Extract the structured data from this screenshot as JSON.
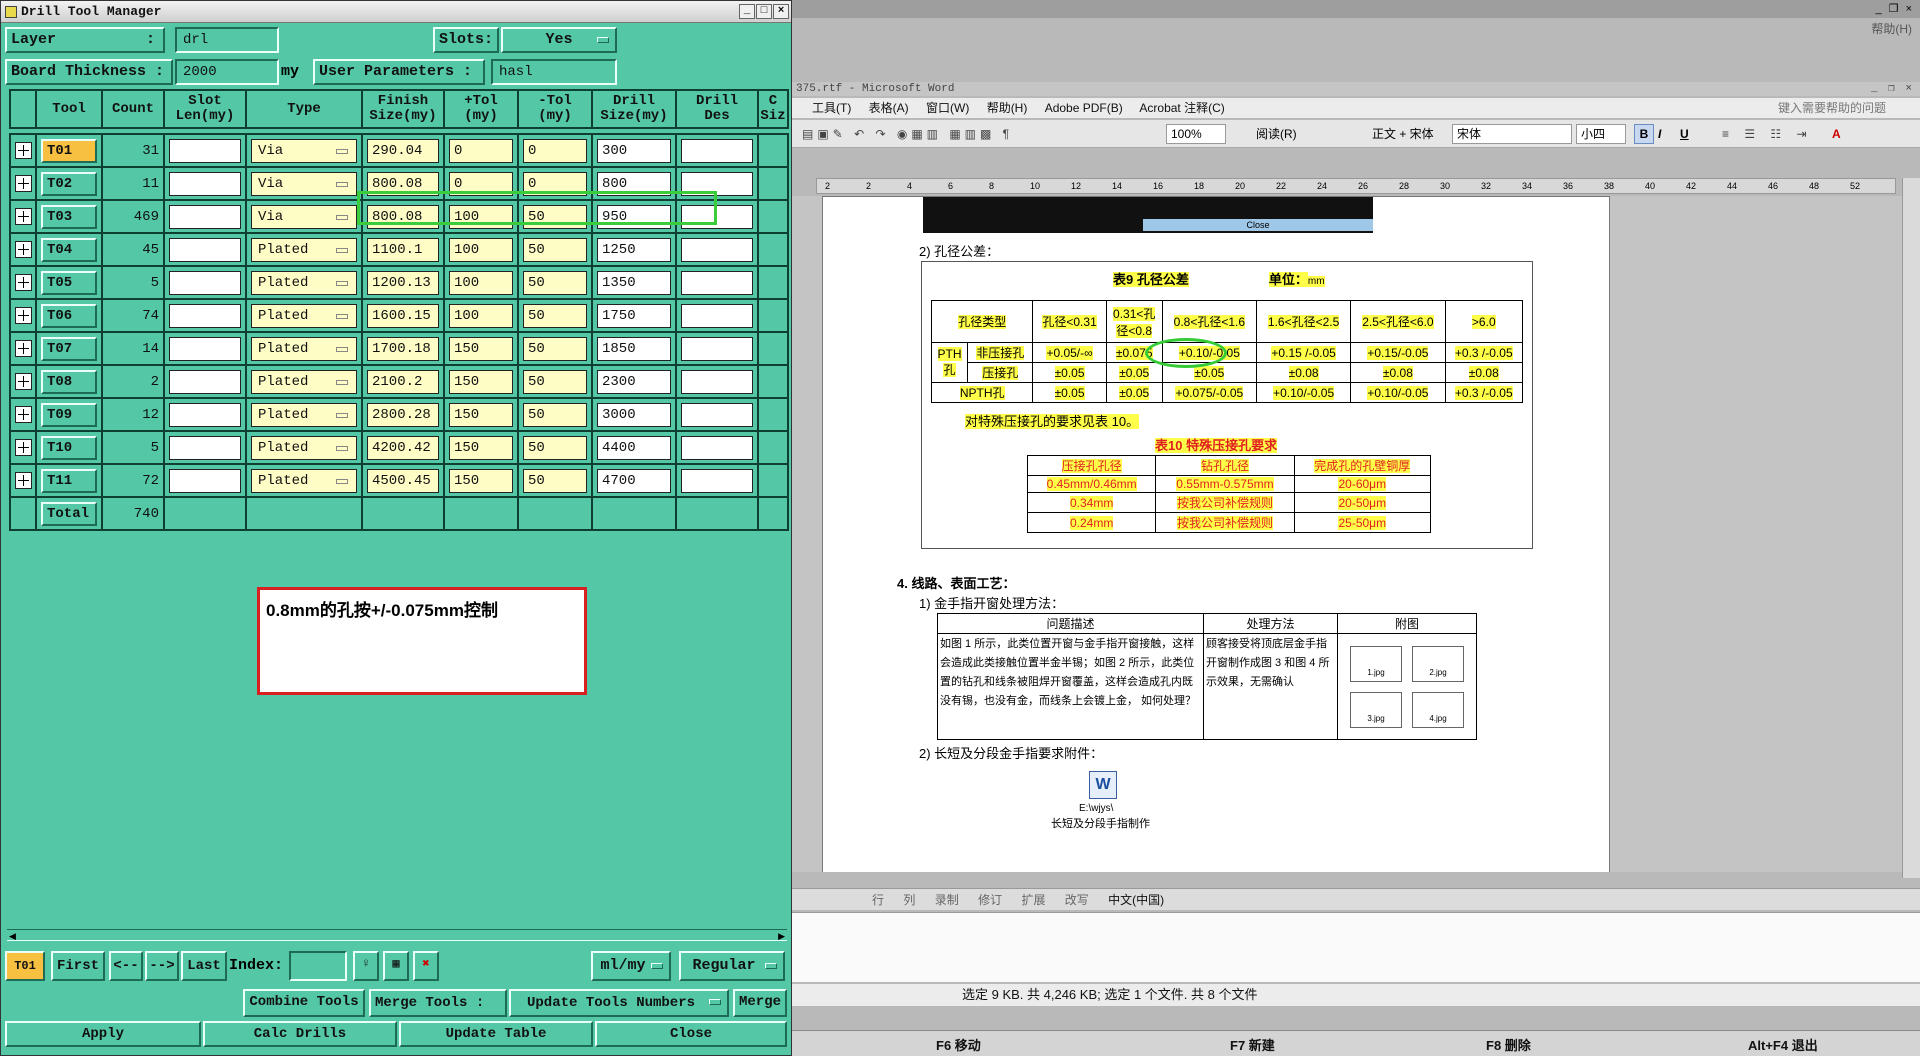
{
  "dtm": {
    "title": "Drill Tool Manager",
    "layer_label": "Layer",
    "layer_colon": ":",
    "layer_value": "drl",
    "slots_label": "Slots:",
    "slots_value": "Yes",
    "thickness_label": "Board Thickness  :",
    "thickness_value": "2000",
    "thickness_unit": "my",
    "userparam_label": "User Parameters  :",
    "userparam_value": "hasl",
    "headers": [
      "Tool",
      "Count",
      "Slot\nLen(my)",
      "Type",
      "Finish\nSize(my)",
      "+Tol\n(my)",
      "-Tol\n(my)",
      "Drill\nSize(my)",
      "Drill\nDes",
      "C\nSiz"
    ],
    "rows": [
      {
        "tool": "T01",
        "count": "31",
        "type": "Via",
        "finish": "290.04",
        "ptol": "0",
        "ntol": "0",
        "drill": "300"
      },
      {
        "tool": "T02",
        "count": "11",
        "type": "Via",
        "finish": "800.08",
        "ptol": "0",
        "ntol": "0",
        "drill": "800"
      },
      {
        "tool": "T03",
        "count": "469",
        "type": "Via",
        "finish": "800.08",
        "ptol": "100",
        "ntol": "50",
        "drill": "950"
      },
      {
        "tool": "T04",
        "count": "45",
        "type": "Plated",
        "finish": "1100.1",
        "ptol": "100",
        "ntol": "50",
        "drill": "1250"
      },
      {
        "tool": "T05",
        "count": "5",
        "type": "Plated",
        "finish": "1200.13",
        "ptol": "100",
        "ntol": "50",
        "drill": "1350"
      },
      {
        "tool": "T06",
        "count": "74",
        "type": "Plated",
        "finish": "1600.15",
        "ptol": "100",
        "ntol": "50",
        "drill": "1750"
      },
      {
        "tool": "T07",
        "count": "14",
        "type": "Plated",
        "finish": "1700.18",
        "ptol": "150",
        "ntol": "50",
        "drill": "1850"
      },
      {
        "tool": "T08",
        "count": "2",
        "type": "Plated",
        "finish": "2100.2",
        "ptol": "150",
        "ntol": "50",
        "drill": "2300"
      },
      {
        "tool": "T09",
        "count": "12",
        "type": "Plated",
        "finish": "2800.28",
        "ptol": "150",
        "ntol": "50",
        "drill": "3000"
      },
      {
        "tool": "T10",
        "count": "5",
        "type": "Plated",
        "finish": "4200.42",
        "ptol": "150",
        "ntol": "50",
        "drill": "4400"
      },
      {
        "tool": "T11",
        "count": "72",
        "type": "Plated",
        "finish": "4500.45",
        "ptol": "150",
        "ntol": "50",
        "drill": "4700"
      }
    ],
    "total_label": "Total",
    "total_count": "740",
    "annotation": "0.8mm的孔按+/-0.075mm控制",
    "nav": {
      "current": "T01",
      "first": "First",
      "prev": "<--",
      "next": "-->",
      "last": "Last",
      "index_label": "Index:",
      "units": "ml/my",
      "mode": "Regular"
    },
    "actions": {
      "combine": "Combine Tools",
      "merge_label": "Merge Tools :",
      "update_numbers": "Update Tools Numbers",
      "merge": "Merge",
      "apply": "Apply",
      "calc": "Calc Drills",
      "update_table": "Update Table",
      "close": "Close"
    }
  },
  "word": {
    "help_menu": "帮助(H)",
    "title": "375.rtf - Microsoft Word",
    "menus": [
      "工具(T)",
      "表格(A)",
      "窗口(W)",
      "帮助(H)",
      "Adobe PDF(B)",
      "Acrobat 注释(C)"
    ],
    "help_search": "键入需要帮助的问题",
    "zoom": "100%",
    "read_btn": "阅读(R)",
    "style": "正文 + 宋体",
    "font": "宋体",
    "size": "小四",
    "ruler_ticks": [
      "2",
      "2",
      "4",
      "6",
      "8",
      "10",
      "12",
      "14",
      "16",
      "18",
      "20",
      "22",
      "24",
      "26",
      "28",
      "30",
      "32",
      "34",
      "36",
      "38",
      "40",
      "42",
      "44",
      "46",
      "48",
      "52"
    ],
    "close_img_text": "Close",
    "section2": "2)  孔径公差：",
    "table9_title": "表9  孔径公差",
    "table9_unit_label": "单位：",
    "table9_unit": "mm",
    "t9_header": [
      "孔径类型",
      "孔径<0.31",
      "0.31<孔径<0.8",
      "0.8<孔径<1.6",
      "1.6<孔径<2.5",
      "2.5<孔径<6.0",
      ">6.0"
    ],
    "t9_pth": "PTH孔",
    "t9_r1_label": "非压接孔",
    "t9_r1": [
      "+0.05/-∞",
      "±0.075",
      "+0.10/-0.05",
      "+0.15 /-0.05",
      "+0.15/-0.05",
      "+0.3 /-0.05"
    ],
    "t9_r2_label": "压接孔",
    "t9_r2": [
      "±0.05",
      "±0.05",
      "±0.05",
      "±0.08",
      "±0.08",
      "±0.08"
    ],
    "t9_r3_label": "NPTH孔",
    "t9_r3": [
      "±0.05",
      "±0.05",
      "+0.075/-0.05",
      "+0.10/-0.05",
      "+0.10/-0.05",
      "+0.3 /-0.05"
    ],
    "t9_note": "对特殊压接孔的要求见表 10。",
    "table10_title": "表10  特殊压接孔要求",
    "t10_header": [
      "压接孔孔径",
      "钻孔孔径",
      "完成孔的孔壁铜厚"
    ],
    "t10_rows": [
      [
        "0.45mm/0.46mm",
        "0.55mm-0.575mm",
        "20-60μm"
      ],
      [
        "0.34mm",
        "按我公司补偿规则",
        "20-50μm"
      ],
      [
        "0.24mm",
        "按我公司补偿规则",
        "25-50μm"
      ]
    ],
    "section4": "4.  线路、表面工艺：",
    "section4_1": "1)  金手指开窗处理方法：",
    "t4_header": [
      "问题描述",
      "处理方法",
      "附图"
    ],
    "t4_desc": "如图 1 所示，此类位置开窗与金手指开窗接触，这样会造成此类接触位置半金半锡；如图 2 所示，此类位置的钻孔和线条被阻焊开窗覆盖，这样会造成孔内既没有锡，也没有金，而线条上会镀上金， 如何处理？",
    "t4_method": "顾客接受将顶底层金手指开窗制作成图 3 和图 4 所示效果，无需确认",
    "t4_imgs": [
      "1.jpg",
      "2.jpg",
      "3.jpg",
      "4.jpg"
    ],
    "section4_2": "2)  长短及分段金手指要求附件：",
    "attach_path": "E:\\wjys\\",
    "attach_name": "长短及分段手指制作",
    "status_items": [
      "行",
      "列",
      "录制",
      "修订",
      "扩展",
      "改写",
      "中文(中国)"
    ],
    "fileinfo": "选定 9 KB. 共 4,246 KB; 选定 1 个文件. 共 8 个文件",
    "fkeys": [
      "F6 移动",
      "F7 新建",
      "F8 删除",
      "Alt+F4 退出"
    ]
  }
}
